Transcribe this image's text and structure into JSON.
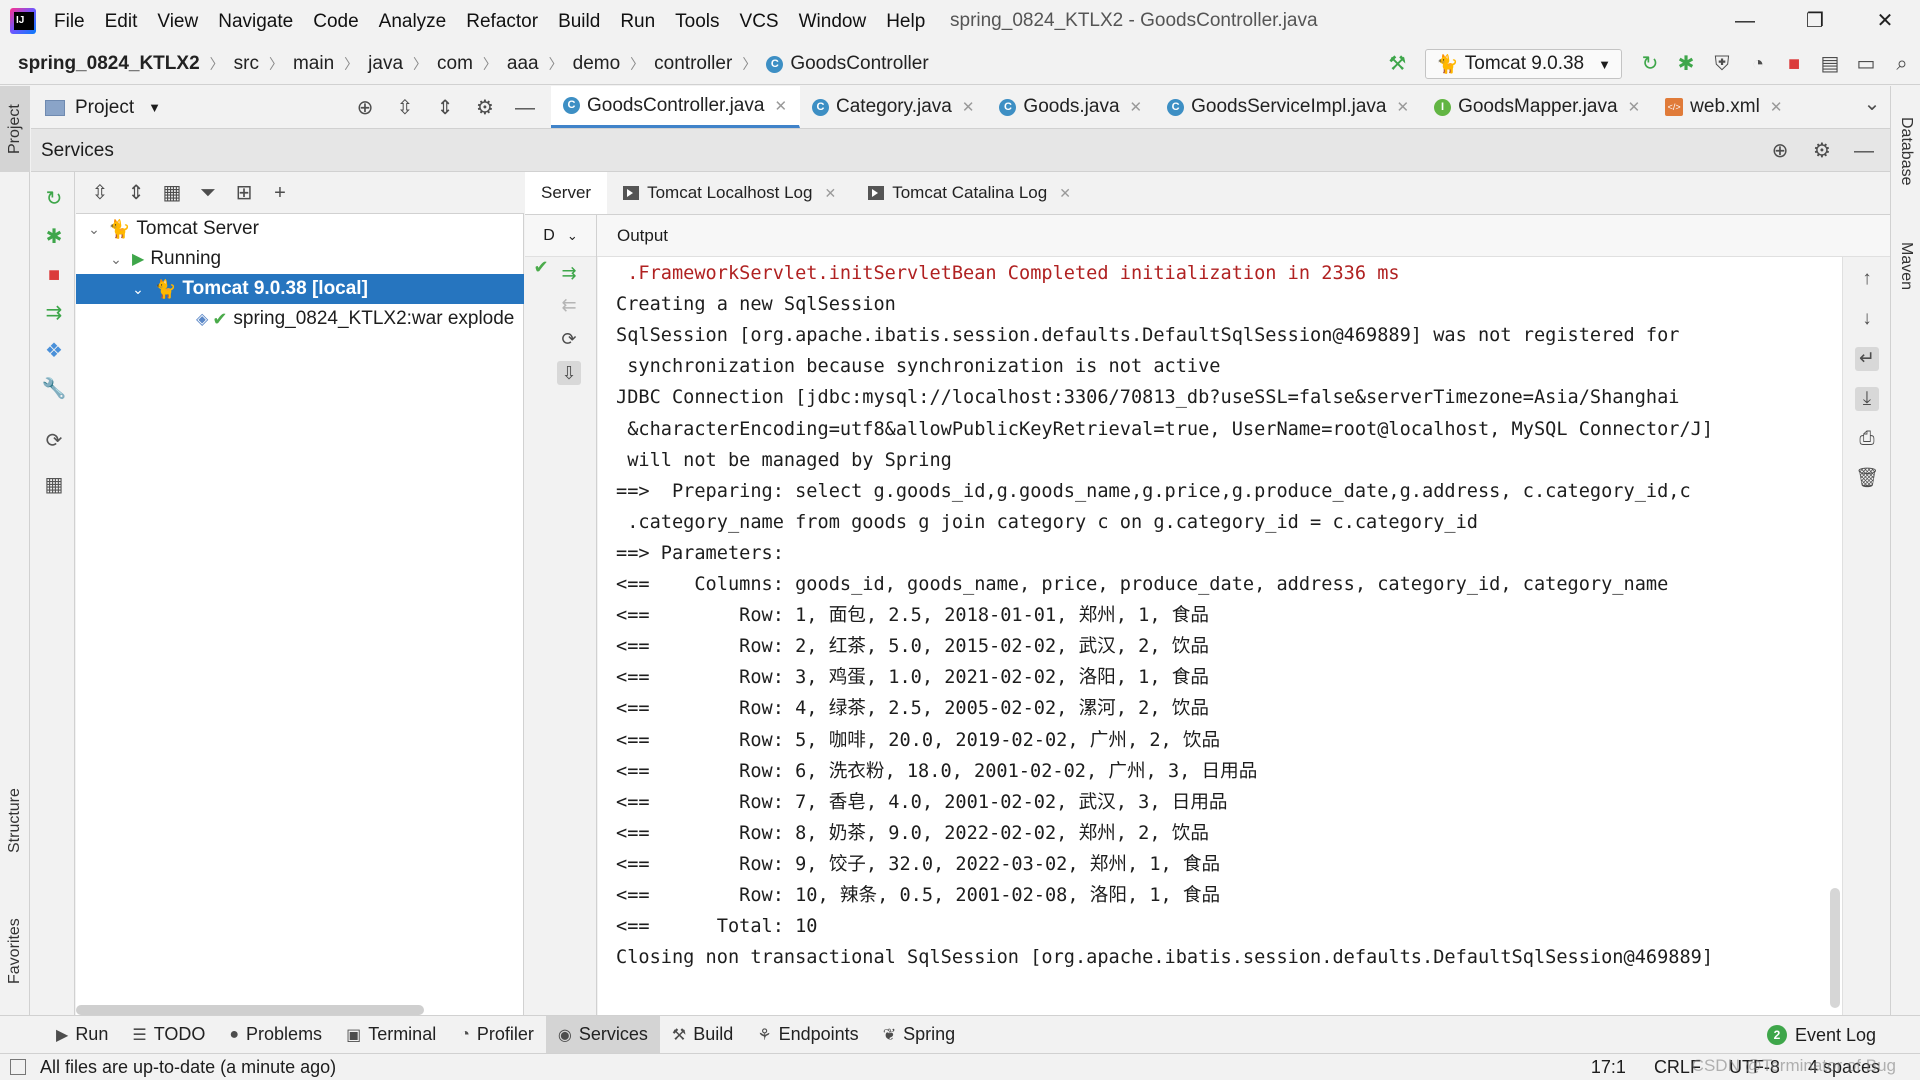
{
  "menubar": {
    "items": [
      "File",
      "Edit",
      "View",
      "Navigate",
      "Code",
      "Analyze",
      "Refactor",
      "Build",
      "Run",
      "Tools",
      "VCS",
      "Window",
      "Help"
    ],
    "title": "spring_0824_KTLX2 - GoodsController.java",
    "minimize": "—",
    "restore": "❐",
    "close": "✕"
  },
  "navbar": {
    "breadcrumbs": [
      "spring_0824_KTLX2",
      "src",
      "main",
      "java",
      "com",
      "aaa",
      "demo",
      "controller",
      "GoodsController"
    ],
    "run_config": "Tomcat 9.0.38"
  },
  "project_header": {
    "title": "Project"
  },
  "editor_tabs": [
    {
      "label": "GoodsController.java",
      "icon": "C",
      "active": true
    },
    {
      "label": "Category.java",
      "icon": "C"
    },
    {
      "label": "Goods.java",
      "icon": "C"
    },
    {
      "label": "GoodsServiceImpl.java",
      "icon": "C"
    },
    {
      "label": "GoodsMapper.java",
      "icon": "I"
    },
    {
      "label": "web.xml",
      "icon": "xml"
    }
  ],
  "services": {
    "title": "Services",
    "tree": {
      "server": "Tomcat Server",
      "running": "Running",
      "instance": "Tomcat 9.0.38 [local]",
      "artifact": "spring_0824_KTLX2:war explode"
    },
    "output_tabs": [
      "Server",
      "Tomcat Localhost Log",
      "Tomcat Catalina Log"
    ],
    "deploy_col": "D",
    "output_label": "Output"
  },
  "console_lines": [
    {
      "text": " .FrameworkServlet.initServletBean Completed initialization in 2336 ms",
      "color": "#b02121"
    },
    {
      "text": "Creating a new SqlSession"
    },
    {
      "text": "SqlSession [org.apache.ibatis.session.defaults.DefaultSqlSession@469889] was not registered for"
    },
    {
      "text": " synchronization because synchronization is not active"
    },
    {
      "text": "JDBC Connection [jdbc:mysql://localhost:3306/70813_db?useSSL=false&serverTimezone=Asia/Shanghai"
    },
    {
      "text": " &characterEncoding=utf8&allowPublicKeyRetrieval=true, UserName=root@localhost, MySQL Connector/J]"
    },
    {
      "text": " will not be managed by Spring"
    },
    {
      "text": "==>  Preparing: select g.goods_id,g.goods_name,g.price,g.produce_date,g.address, c.category_id,c"
    },
    {
      "text": " .category_name from goods g join category c on g.category_id = c.category_id"
    },
    {
      "text": "==> Parameters: "
    },
    {
      "text": "<==    Columns: goods_id, goods_name, price, produce_date, address, category_id, category_name"
    },
    {
      "text": "<==        Row: 1, 面包, 2.5, 2018-01-01, 郑州, 1, 食品"
    },
    {
      "text": "<==        Row: 2, 红茶, 5.0, 2015-02-02, 武汉, 2, 饮品"
    },
    {
      "text": "<==        Row: 3, 鸡蛋, 1.0, 2021-02-02, 洛阳, 1, 食品"
    },
    {
      "text": "<==        Row: 4, 绿茶, 2.5, 2005-02-02, 漯河, 2, 饮品"
    },
    {
      "text": "<==        Row: 5, 咖啡, 20.0, 2019-02-02, 广州, 2, 饮品"
    },
    {
      "text": "<==        Row: 6, 洗衣粉, 18.0, 2001-02-02, 广州, 3, 日用品"
    },
    {
      "text": "<==        Row: 7, 香皂, 4.0, 2001-02-02, 武汉, 3, 日用品"
    },
    {
      "text": "<==        Row: 8, 奶茶, 9.0, 2022-02-02, 郑州, 2, 饮品"
    },
    {
      "text": "<==        Row: 9, 饺子, 32.0, 2022-03-02, 郑州, 1, 食品"
    },
    {
      "text": "<==        Row: 10, 辣条, 0.5, 2001-02-08, 洛阳, 1, 食品"
    },
    {
      "text": "<==      Total: 10"
    },
    {
      "text": "Closing non transactional SqlSession [org.apache.ibatis.session.defaults.DefaultSqlSession@469889]"
    }
  ],
  "left_strip": {
    "project": "Project",
    "structure": "Structure",
    "favorites": "Favorites"
  },
  "right_strip": {
    "database": "Database",
    "maven": "Maven"
  },
  "bottom_tabs": [
    {
      "label": "Run",
      "icon": "▶"
    },
    {
      "label": "TODO",
      "icon": "☰"
    },
    {
      "label": "Problems",
      "icon": "●"
    },
    {
      "label": "Terminal",
      "icon": "▣"
    },
    {
      "label": "Profiler",
      "icon": "◔"
    },
    {
      "label": "Services",
      "icon": "◉",
      "active": true
    },
    {
      "label": "Build",
      "icon": "⚒"
    },
    {
      "label": "Endpoints",
      "icon": "⚘"
    },
    {
      "label": "Spring",
      "icon": "❦"
    }
  ],
  "event_log": {
    "label": "Event Log",
    "count": "2"
  },
  "status": {
    "message": "All files are up-to-date (a minute ago)",
    "position": "17:1",
    "line_sep": "CRLF",
    "encoding": "UTF-8",
    "indent": "4 spaces",
    "watermark": "CSDN @Terminator of Bug"
  },
  "colors": {
    "accent": "#2675bf",
    "error": "#b02121",
    "success": "#3ea64a"
  }
}
